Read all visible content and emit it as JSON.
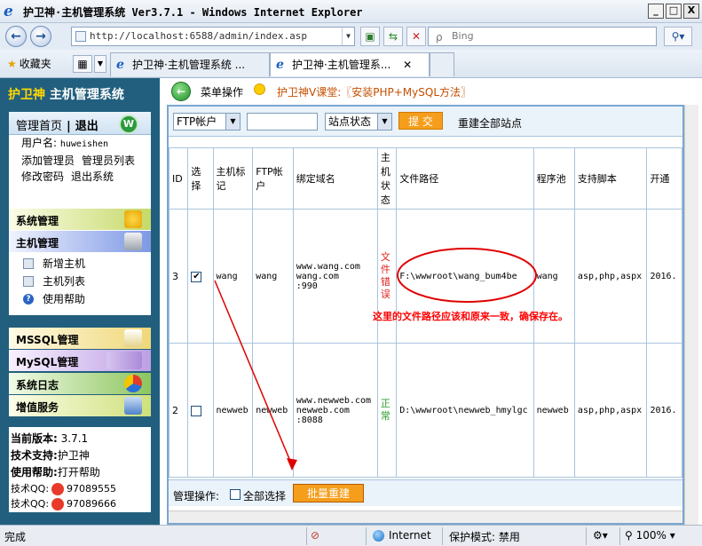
{
  "window": {
    "title": "护卫神·主机管理系统 Ver3.7.1 - Windows Internet Explorer",
    "ie_logo": "e",
    "controls": [
      "_",
      "□",
      "X"
    ]
  },
  "browser": {
    "url": "http://localhost:6588/admin/index.asp",
    "search_placeholder": "Bing",
    "favorites": "收藏夹",
    "tabs": [
      {
        "label": "护卫神·主机管理系统 ..."
      },
      {
        "label": "护卫神·主机管理系..."
      }
    ]
  },
  "sidebar": {
    "brand_left": "护卫神",
    "brand_right": "主机管理系统",
    "home": "管理首页",
    "logout": "退出",
    "badge": "W",
    "username_label": "用户名:",
    "username": "huweishen",
    "links": [
      "添加管理员",
      "管理员列表",
      "修改密码",
      "退出系统"
    ],
    "menu": {
      "system": "系统管理",
      "host": "主机管理",
      "host_sub": [
        "新增主机",
        "主机列表",
        "使用帮助"
      ],
      "mssql": "MSSQL管理",
      "mysql": "MySQL管理",
      "log": "系统日志",
      "vas": "增值服务"
    },
    "info": {
      "version_label": "当前版本:",
      "version": "3.7.1",
      "support_label": "技术支持:",
      "support": "护卫神",
      "help_label": "使用帮助:",
      "help": "打开帮助",
      "qq_label": "技术QQ:",
      "qq1": "97089555",
      "qq2": "97089666"
    }
  },
  "main": {
    "op_label": "菜单操作",
    "course": "护卫神V课堂:〖安装PHP+MySQL方法〗",
    "toolbar": {
      "filter_select": "FTP帐户",
      "status_select": "站点状态",
      "submit": "提 交",
      "rebuild_all": "重建全部站点"
    },
    "table": {
      "headers": [
        "ID",
        "选择",
        "主机标记",
        "FTP帐户",
        "绑定域名",
        "主机状态",
        "文件路径",
        "程序池",
        "支持脚本",
        "开通"
      ],
      "rows": [
        {
          "id": "3",
          "checked": "✔",
          "tag": "wang",
          "ftp": "wang",
          "domain1": "www.wang.com",
          "domain2": "wang.com",
          "domain3": ":990",
          "status": "文件错误",
          "path": "F:\\wwwroot\\wang_bum4be",
          "pool": "wang",
          "scripts": "asp,php,aspx",
          "date": "2016."
        },
        {
          "id": "2",
          "checked": "",
          "tag": "newweb",
          "ftp": "newweb",
          "domain1": "www.newweb.com",
          "domain2": "newweb.com",
          "domain3": ":8088",
          "status": "正常",
          "path": "D:\\wwwroot\\newweb_hmylgc",
          "pool": "newweb",
          "scripts": "asp,php,aspx",
          "date": "2016."
        }
      ]
    },
    "annotation": "这里的文件路径应该和原来一致，确保存在。",
    "footer": {
      "label": "管理操作:",
      "select_all": "全部选择",
      "batch_rebuild": "批量重建"
    }
  },
  "statusbar": {
    "status": "完成",
    "zone": "Internet",
    "protected": "保护模式: 禁用",
    "zoom": "100%"
  },
  "colors": {
    "sidebar": "#225f7e",
    "accent_orange": "#f59e1c",
    "error_red": "#e02020",
    "ok_green": "#2c9e2c",
    "annotation_red": "#ff0000"
  }
}
